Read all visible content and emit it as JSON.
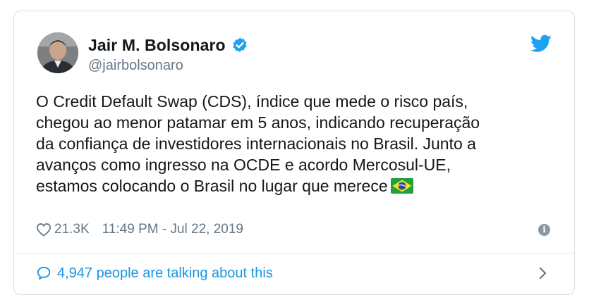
{
  "tweet": {
    "author_name": "Jair M. Bolsonaro",
    "handle": "@jairbolsonaro",
    "text": "O Credit Default Swap (CDS), índice que mede o risco país,\nchegou ao menor patamar em 5 anos, indicando recuperação\nda confiança de investidores internacionais no Brasil. Junto a\navanços como ingresso na OCDE e acordo Mercosul-UE,\nestamos colocando o Brasil no lugar que merece",
    "like_count": "21.3K",
    "timestamp": "11:49 PM - Jul 22, 2019",
    "info_glyph": "i"
  },
  "footer": {
    "talking_text": "4,947 people are talking about this"
  },
  "icons": {
    "verified": "verified-badge-icon",
    "brand": "twitter-bird-icon",
    "flag": "brazil-flag-emoji",
    "like": "heart-icon",
    "info": "info-icon",
    "reply": "speech-bubble-icon",
    "chevron": "chevron-right-icon"
  },
  "colors": {
    "accent": "#1da1f2",
    "link": "#1b95e0",
    "text": "#14171a",
    "muted": "#657786",
    "border": "#d7dde2"
  }
}
